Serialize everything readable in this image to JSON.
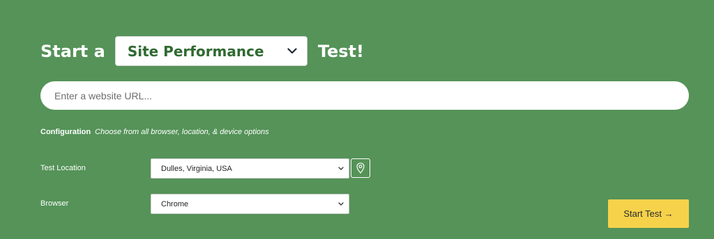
{
  "header": {
    "prefix": "Start a",
    "test_type_selected": "Site Performance",
    "suffix": "Test!"
  },
  "url_input": {
    "placeholder": "Enter a website URL..."
  },
  "configuration": {
    "label": "Configuration",
    "hint": "Choose from all browser, location, & device options"
  },
  "test_location": {
    "label": "Test Location",
    "value": "Dulles, Virginia, USA"
  },
  "browser": {
    "label": "Browser",
    "value": "Chrome"
  },
  "start_button": {
    "label": "Start Test →"
  },
  "icons": {
    "test_type_dropdown": "chevron-down-icon",
    "location_dropdown": "chevron-down-icon",
    "browser_dropdown": "chevron-down-icon",
    "location_pin": "map-pin-icon"
  },
  "colors": {
    "background": "#559358",
    "accent_button": "#f6d24b",
    "select_text": "#2f6a31"
  }
}
